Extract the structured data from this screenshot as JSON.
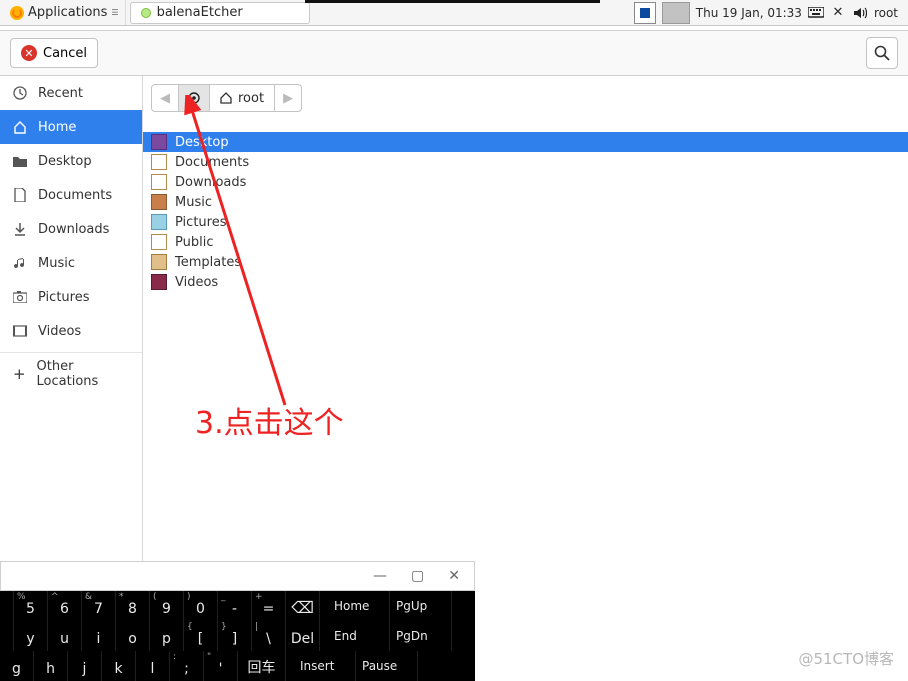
{
  "os": {
    "applications_label": "Applications",
    "task_app": "balenaEtcher",
    "clock": "Thu 19 Jan, 01:33",
    "user": "root"
  },
  "dialog": {
    "cancel": "Cancel",
    "path_root": "root"
  },
  "sidebar": {
    "items": [
      {
        "label": "Recent",
        "icon": "clock"
      },
      {
        "label": "Home",
        "icon": "home"
      },
      {
        "label": "Desktop",
        "icon": "folder"
      },
      {
        "label": "Documents",
        "icon": "doc"
      },
      {
        "label": "Downloads",
        "icon": "download"
      },
      {
        "label": "Music",
        "icon": "music"
      },
      {
        "label": "Pictures",
        "icon": "camera"
      },
      {
        "label": "Videos",
        "icon": "video"
      }
    ],
    "other": "Other Locations"
  },
  "files": [
    {
      "name": "Desktop",
      "cls": "desktop"
    },
    {
      "name": "Documents",
      "cls": "doc"
    },
    {
      "name": "Downloads",
      "cls": "dl"
    },
    {
      "name": "Music",
      "cls": "music"
    },
    {
      "name": "Pictures",
      "cls": "pic"
    },
    {
      "name": "Public",
      "cls": "pub"
    },
    {
      "name": "Templates",
      "cls": "tpl"
    },
    {
      "name": "Videos",
      "cls": "vid"
    }
  ],
  "annotation": {
    "text": "3.点击这个"
  },
  "watermark": "@51CTO博客",
  "osk": {
    "min": "—",
    "max": "▢",
    "close": "✕",
    "row1": [
      {
        "m": "5",
        "s": "%"
      },
      {
        "m": "6",
        "s": "^"
      },
      {
        "m": "7",
        "s": "&"
      },
      {
        "m": "8",
        "s": "*"
      },
      {
        "m": "9",
        "s": "("
      },
      {
        "m": "0",
        "s": ")"
      },
      {
        "m": "-",
        "s": "_"
      },
      {
        "m": "=",
        "s": "+"
      }
    ],
    "bksp": "⌫",
    "row1_funcs": [
      "Home",
      "PgUp"
    ],
    "row2": [
      {
        "m": "y"
      },
      {
        "m": "u"
      },
      {
        "m": "i"
      },
      {
        "m": "o"
      },
      {
        "m": "p"
      },
      {
        "m": "[",
        "s": "{"
      },
      {
        "m": "]",
        "s": "}"
      },
      {
        "m": "\\",
        "s": "|"
      }
    ],
    "del": "Del",
    "row2_funcs": [
      "End",
      "PgDn"
    ],
    "row3": [
      {
        "m": "g"
      },
      {
        "m": "h"
      },
      {
        "m": "j"
      },
      {
        "m": "k"
      },
      {
        "m": "l"
      },
      {
        "m": ";",
        "s": ":"
      },
      {
        "m": "'",
        "s": "\""
      }
    ],
    "enter": "回车",
    "row3_funcs": [
      "Insert",
      "Pause"
    ]
  }
}
